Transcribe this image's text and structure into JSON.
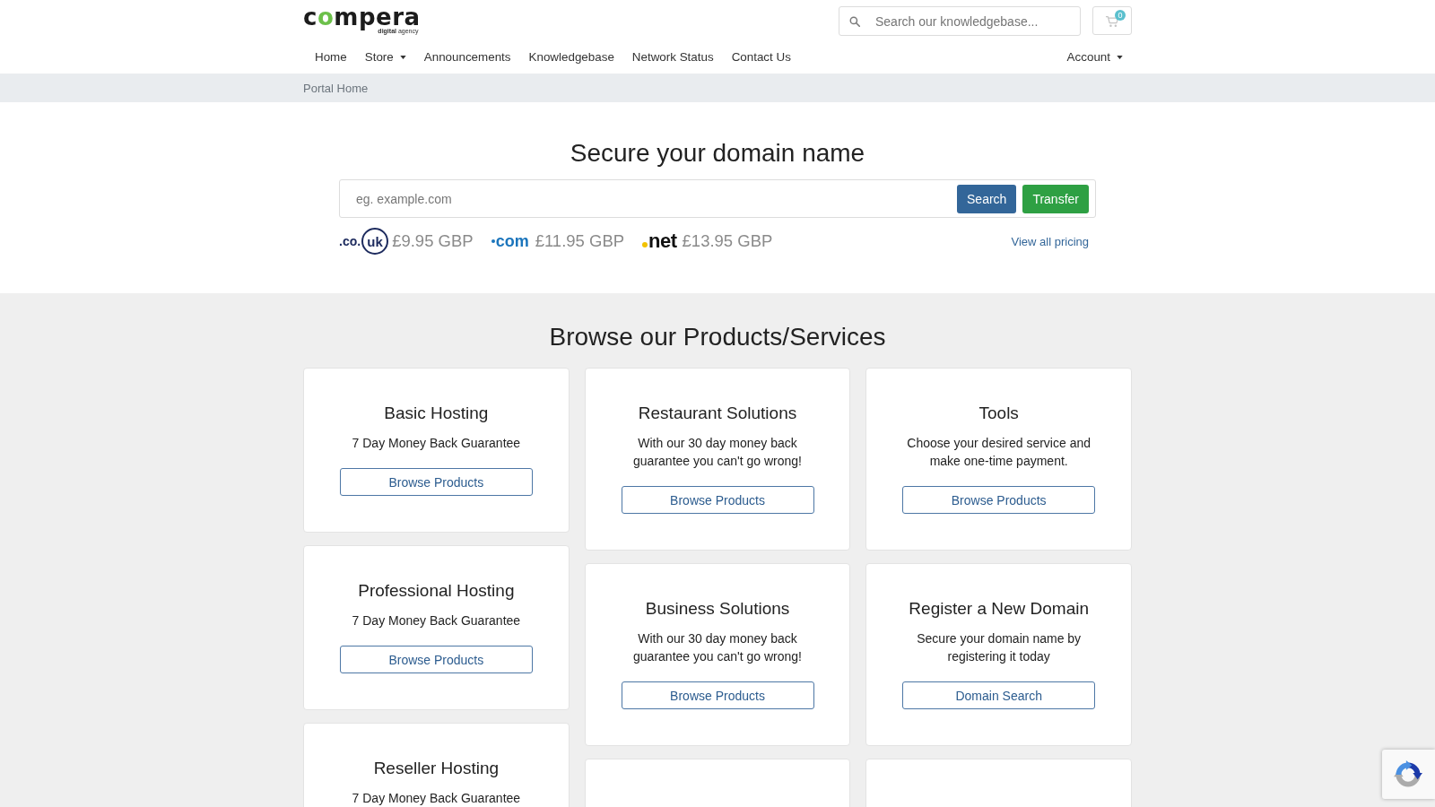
{
  "header": {
    "logo": {
      "parts": [
        {
          "text": "c",
          "accent": false
        },
        {
          "text": "o",
          "accent": true
        },
        {
          "text": "mpera",
          "accent": false
        }
      ],
      "tagline": "**digital** agency"
    },
    "search": {
      "placeholder": "Search our knowledgebase..."
    },
    "cart": {
      "count": "0"
    }
  },
  "nav": {
    "items": [
      {
        "label": "Home",
        "dropdown": false
      },
      {
        "label": "Store",
        "dropdown": true
      },
      {
        "label": "Announcements",
        "dropdown": false
      },
      {
        "label": "Knowledgebase",
        "dropdown": false
      },
      {
        "label": "Network Status",
        "dropdown": false
      },
      {
        "label": "Contact Us",
        "dropdown": false
      }
    ],
    "account": {
      "label": "Account",
      "dropdown": true
    }
  },
  "breadcrumb": [
    "Portal Home"
  ],
  "domain_search": {
    "title": "Secure your domain name",
    "placeholder": "eg. example.com",
    "buttons": [
      {
        "label": "Search",
        "kind": "primary"
      },
      {
        "label": "Transfer",
        "kind": "success"
      }
    ],
    "tlds": [
      {
        "kind": "ring",
        "logo": ".co.",
        "ring": "uk",
        "price": "£9.95 GBP"
      },
      {
        "kind": "bullet",
        "logo": "com",
        "color": "#1b75bc",
        "price": "£11.95 GBP"
      },
      {
        "kind": "dot",
        "logo": "net",
        "color": "#f2c200",
        "price": "£13.95 GBP"
      }
    ],
    "link": "View all pricing"
  },
  "products": {
    "title": "Browse our Products/Services",
    "columns": [
      {
        "cards": [
          {
            "title": "Basic Hosting",
            "description": "7 Day Money Back Guarantee",
            "button": "Browse Products"
          },
          {
            "title": "Professional Hosting",
            "description": "7 Day Money Back Guarantee",
            "button": "Browse Products"
          },
          {
            "title": "Reseller Hosting",
            "description": "7 Day Money Back Guarantee"
          }
        ]
      },
      {
        "partial_card": true,
        "cards": [
          {
            "title": "Restaurant Solutions",
            "description": "With our 30 day money back guarantee you can't go wrong!",
            "button": "Browse Products"
          },
          {
            "title": "Business Solutions",
            "description": "With our 30 day money back guarantee you can't go wrong!",
            "button": "Browse Products"
          }
        ]
      },
      {
        "partial_card": true,
        "cards": [
          {
            "title": "Tools",
            "description": "Choose your desired service and make one-time payment.",
            "button": "Browse Products"
          },
          {
            "title": "Register a New Domain",
            "description": "Secure your domain name by registering it today",
            "button": "Domain Search"
          }
        ]
      }
    ]
  }
}
